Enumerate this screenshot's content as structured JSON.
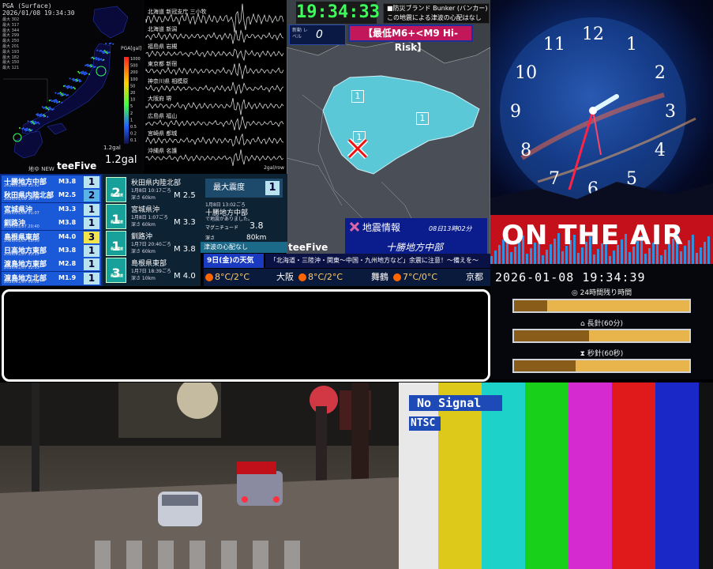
{
  "pga": {
    "header": "PGA (Surface)",
    "timestamp": "2026/01/08 19:34:30",
    "station_list": "最大 302\n最大 317\n最大 344\n最大 299\n最大 250\n最大 201\n最大 193\n最大 182\n最大 150\n最大 121",
    "legend_title": "PGA[gal]",
    "legend_ticks": [
      "1000",
      "500",
      "200",
      "100",
      "50",
      "20",
      "10",
      "5",
      "2",
      "1",
      "0.5",
      "0.2",
      "0.1"
    ],
    "current_small": "1.2gal",
    "current_value": "1.2gal",
    "brand": "teeFive",
    "news_label": "地ゆ NEW"
  },
  "waveforms": {
    "stations": [
      "北海道 新冠支庁 三小牧",
      "北海道 新潟",
      "福島県 岩槻",
      "東京都 新宿",
      "神奈川県 相模原",
      "大阪府 堺",
      "広島県 福山",
      "宮崎県 都城",
      "沖縄県 名護"
    ],
    "unit": "2gal/row"
  },
  "map": {
    "time": "19:34:33",
    "bunker_title": "■防災ブランド Bunker (バンカー)",
    "bunker_text": "この地震による津波の心配はなし",
    "level_label": "新動 レベル",
    "level_value": "0",
    "risk_label": "【最低M6+<M9 Hi-Risk】",
    "intensity_markers": [
      "1",
      "1",
      "1"
    ],
    "brand": "teeFive",
    "eq_title": "地震情報",
    "eq_datetime": "08日13時02分",
    "eq_place": "十勝地方中部"
  },
  "quake_list": [
    {
      "name": "十勝地方中部",
      "date": "2026/01/08 13:02",
      "mag": "M3.8",
      "shindo": "1"
    },
    {
      "name": "秋田県内陸北部",
      "date": "2026/01/08 10:17",
      "mag": "M2.5",
      "shindo": "2"
    },
    {
      "name": "宮城県沖",
      "date": "2026/01/08 01:07",
      "mag": "M3.3",
      "shindo": "1"
    },
    {
      "name": "釧路沖",
      "date": "2026/01/07 20:40",
      "mag": "M3.8",
      "shindo": "1"
    },
    {
      "name": "島根県東部",
      "date": "2026/01/07 18:39",
      "mag": "M4.0",
      "shindo": "3"
    },
    {
      "name": "日高地方東部",
      "date": "2026/01/07 13:35",
      "mag": "M3.8",
      "shindo": "1"
    },
    {
      "name": "渡島地方東部",
      "date": "2026/01/07 12:03",
      "mag": "M2.8",
      "shindo": "1"
    },
    {
      "name": "渡島地方北部",
      "date": "2026/01/07 09:02",
      "mag": "M1.9",
      "shindo": "1"
    }
  ],
  "quake_detail": [
    {
      "place": "秋田県内陸北部",
      "time": "1月8日 10:17ごろ",
      "depth": "深さ 60km",
      "mag": "M 2.5",
      "shindo": "2",
      "shindo_label": "最大震度"
    },
    {
      "place": "宮城県沖",
      "time": "1月8日 1:07ごろ",
      "depth": "深さ 60km",
      "mag": "M 3.3",
      "shindo": "1",
      "shindo_label": "最大震度"
    },
    {
      "place": "釧路沖",
      "time": "1月7日 20:40ごろ",
      "depth": "深さ 60km",
      "mag": "M 3.8",
      "shindo": "1",
      "shindo_label": "最大震度"
    },
    {
      "place": "島根県東部",
      "time": "1月7日 18:39ごろ",
      "depth": "深さ 10km",
      "mag": "M 4.0",
      "shindo": "3",
      "shindo_label": "最大震度"
    }
  ],
  "max_intensity": {
    "label": "最大震度",
    "value": "1",
    "time": "1月8日 13:02ごろ",
    "place": "十勝地方中部",
    "note": "で地震がありました。",
    "mag_label": "マグニチュード",
    "mag_value": "3.8",
    "depth_label": "深さ",
    "depth_value": "80km",
    "tsunami": "津波の心配なし"
  },
  "weather": {
    "date": "9日(金)の天気",
    "ticker": "「北海道・三陸沖・関東〜中国・九州地方など」余震に注意！〜備えを〜",
    "cities": [
      {
        "temp": "8°C/2°C",
        "city": "大阪"
      },
      {
        "temp": "8°C/2°C",
        "city": "舞鶴"
      },
      {
        "temp": "7°C/0°C",
        "city": "京都"
      }
    ]
  },
  "clock": {
    "numerals": [
      "12",
      "1",
      "2",
      "3",
      "4",
      "5",
      "6",
      "7",
      "8",
      "9",
      "10",
      "11"
    ],
    "on_air": "ON THE AIR",
    "datetime": "2026-01-08 19:34:39",
    "bars": [
      {
        "label": "24時間残り時間",
        "fraction": 0.19,
        "icon": "globe-icon"
      },
      {
        "label": "長針(60分)",
        "fraction": 0.43,
        "icon": "clock-icon"
      },
      {
        "label": "秒針(60秒)",
        "fraction": 0.35,
        "icon": "hourglass-icon"
      }
    ]
  },
  "no_signal": {
    "text": "No Signal",
    "standard": "NTSC",
    "bar_colors": [
      "#e8e8e8",
      "#dcc91a",
      "#1dd2c8",
      "#18d01a",
      "#d42ad0",
      "#e01a1a",
      "#1a28c8",
      "#111111"
    ]
  },
  "colors": {
    "shindo1": "#b9e4ef",
    "shindo2": "#5bb4e6",
    "shindo3": "#f5e44a",
    "on_air": "#c4101a",
    "map_land": "#5bc8d8"
  }
}
